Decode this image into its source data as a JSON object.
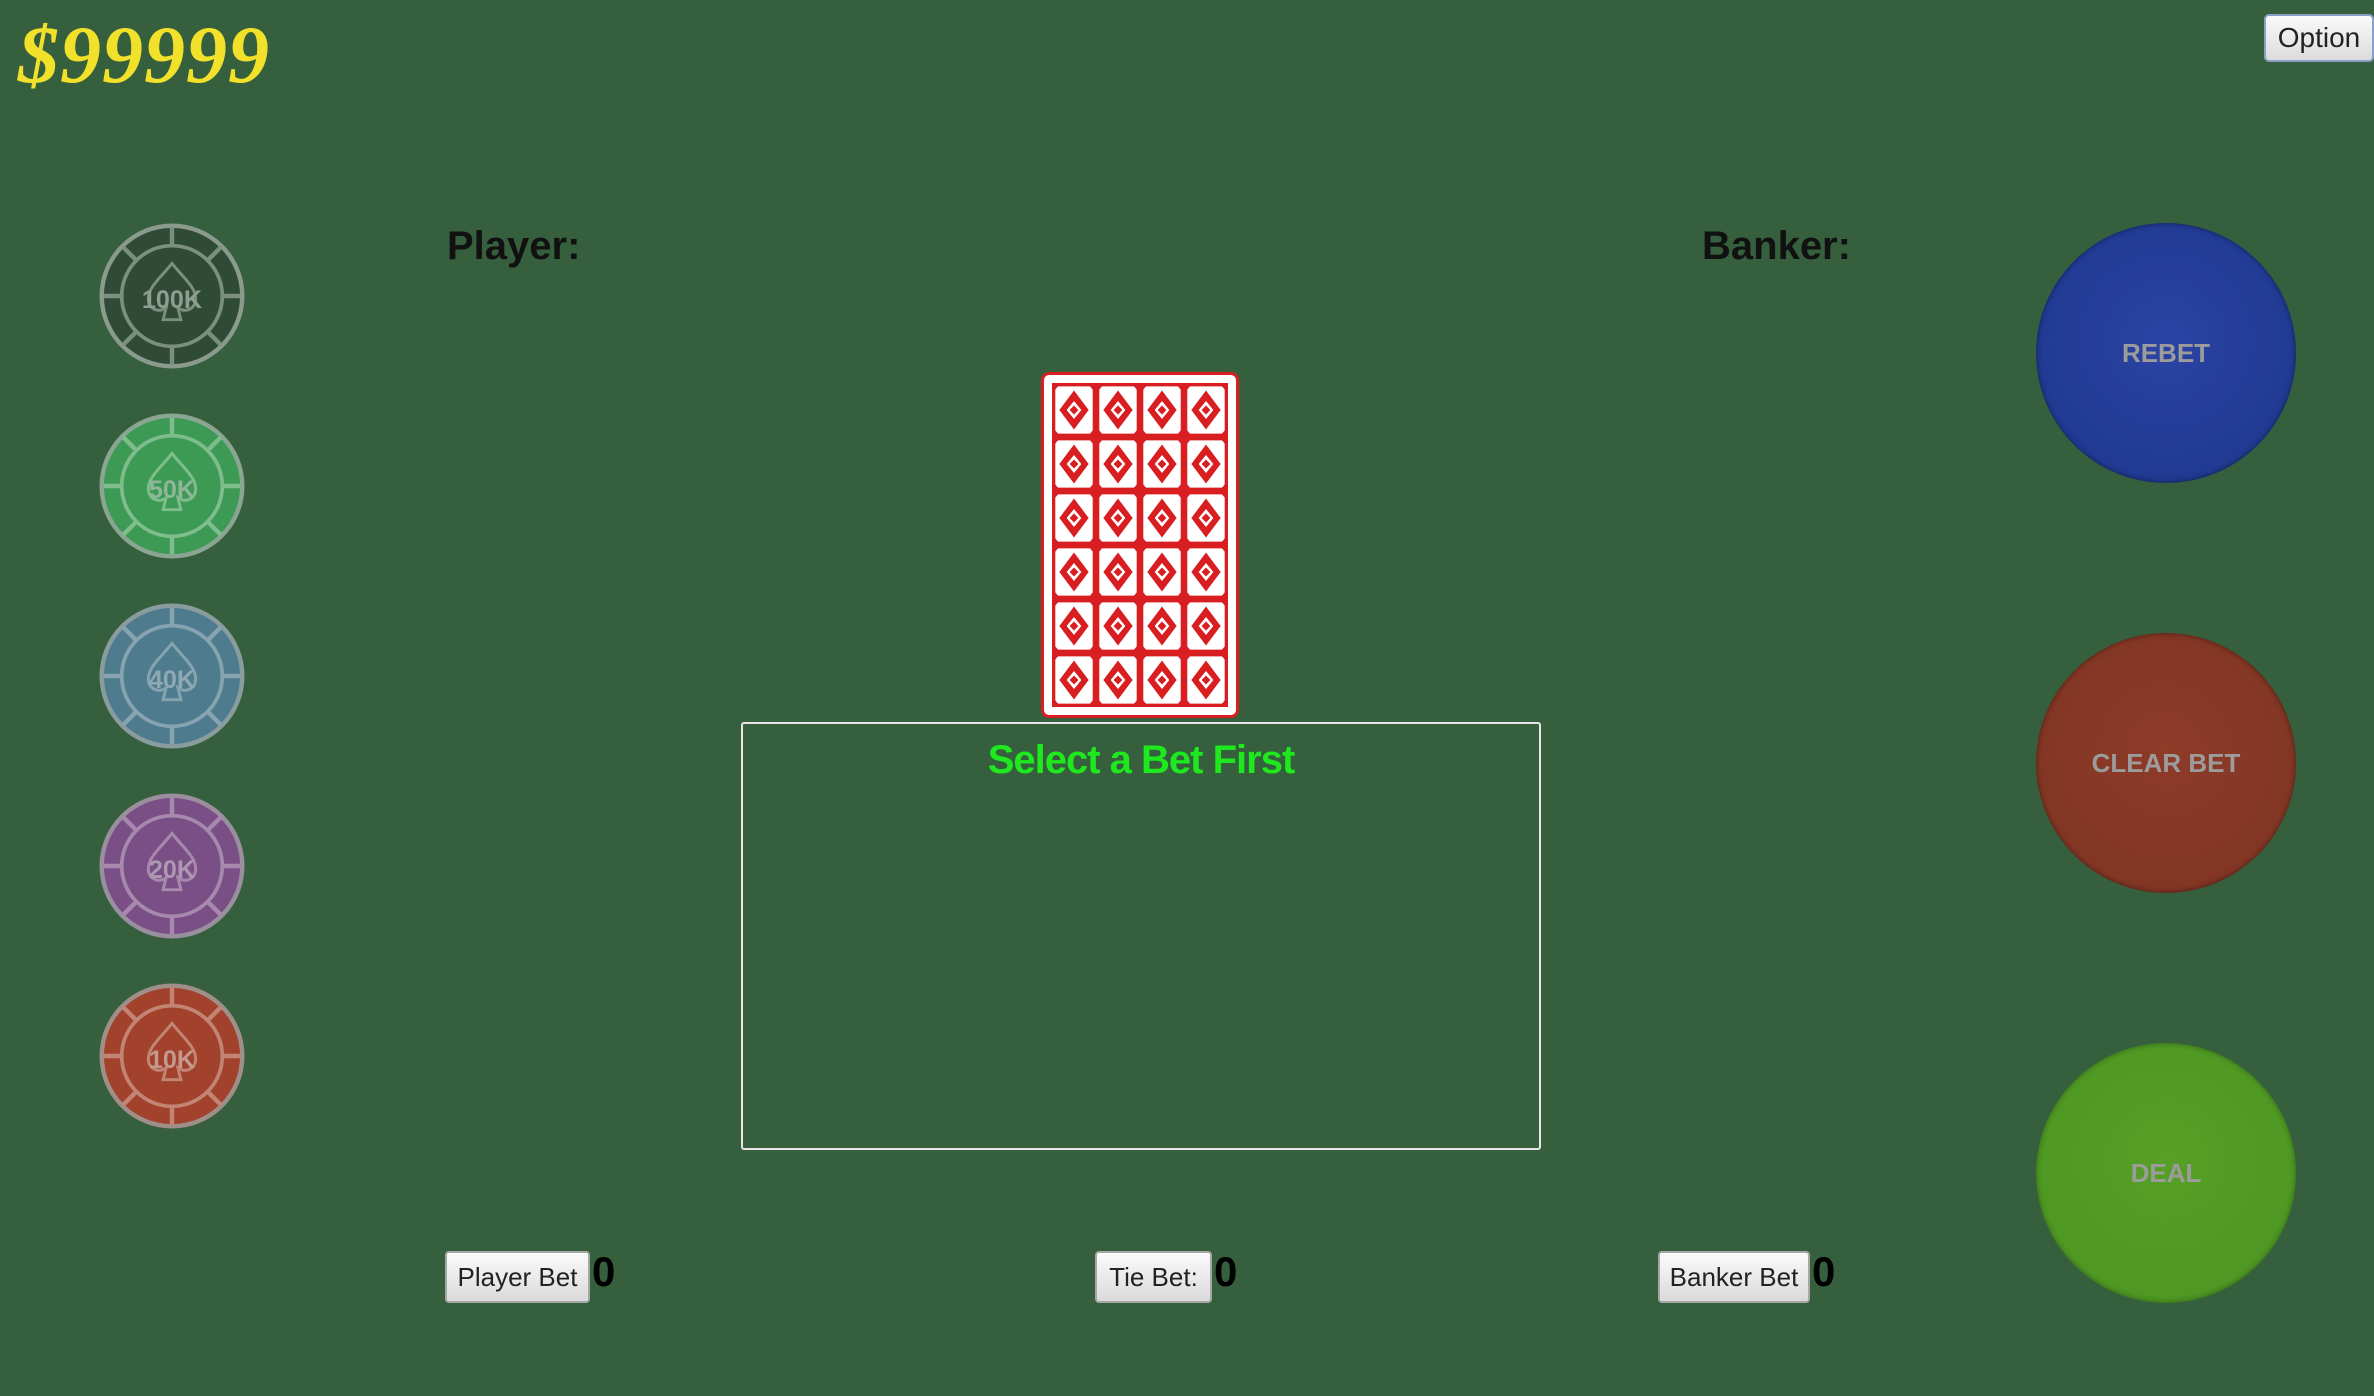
{
  "balance": "$99999",
  "option_button": "Option",
  "chips": [
    {
      "label": "100K",
      "color": "#2f4a36"
    },
    {
      "label": "50K",
      "color": "#3c9a55"
    },
    {
      "label": "40K",
      "color": "#4f7b8f"
    },
    {
      "label": "20K",
      "color": "#7a4f86"
    },
    {
      "label": "10K",
      "color": "#a2422c"
    }
  ],
  "player_label": "Player:",
  "banker_label": "Banker:",
  "message": "Select a Bet First",
  "actions": {
    "rebet": "REBET",
    "clear_bet": "CLEAR BET",
    "deal": "DEAL"
  },
  "bets": {
    "player_label": "Player Bet",
    "player_amount": "0",
    "tie_label": "Tie Bet:",
    "tie_amount": "0",
    "banker_label": "Banker Bet",
    "banker_amount": "0"
  },
  "colors": {
    "table": "#365f3d",
    "balance": "#f2e12a",
    "message": "#1ee81e",
    "card_back": "#d81e20"
  }
}
